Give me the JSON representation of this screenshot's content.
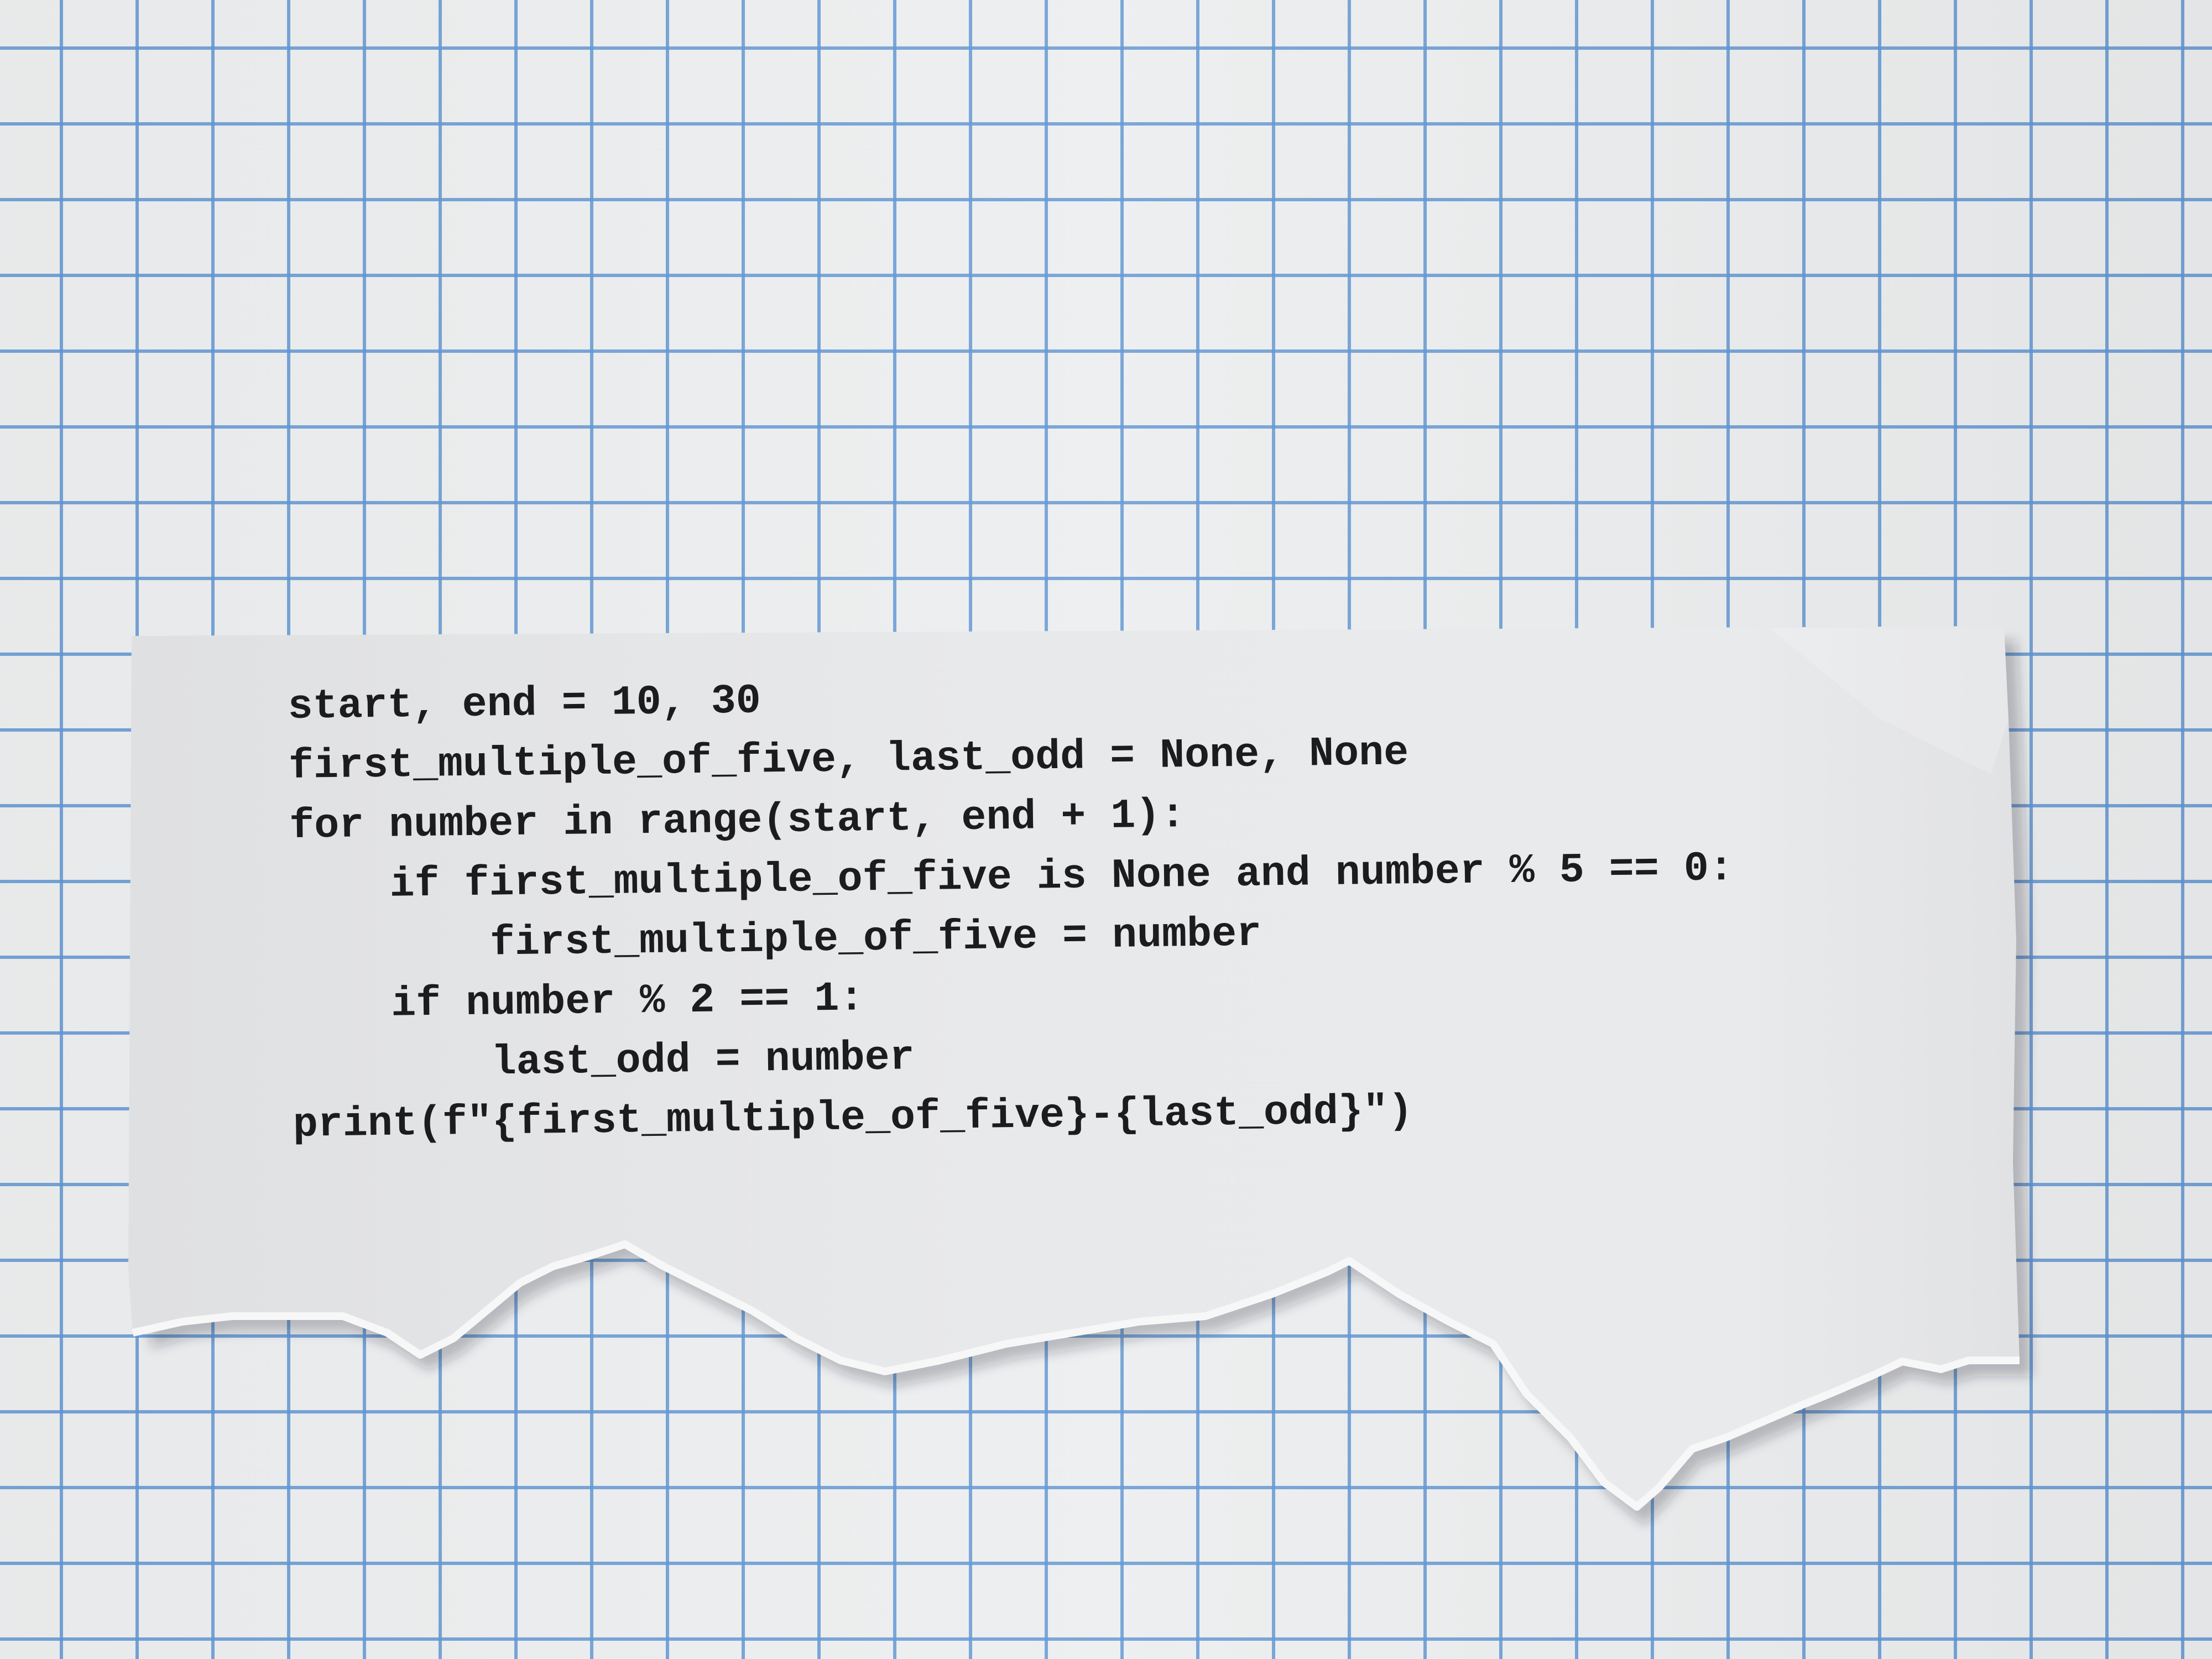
{
  "code": {
    "language": "python",
    "lines": [
      "start, end = 10, 30",
      "first_multiple_of_five, last_odd = None, None",
      "for number in range(start, end + 1):",
      "    if first_multiple_of_five is None and number % 5 == 0:",
      "        first_multiple_of_five = number",
      "    if number % 2 == 1:",
      "        last_odd = number",
      "print(f\"{first_multiple_of_five}-{last_odd}\")"
    ]
  },
  "colors": {
    "grid_line": "#6096d2",
    "background": "#eceeef",
    "paper": "#e6e7e9",
    "ink": "#1c1c1e"
  }
}
